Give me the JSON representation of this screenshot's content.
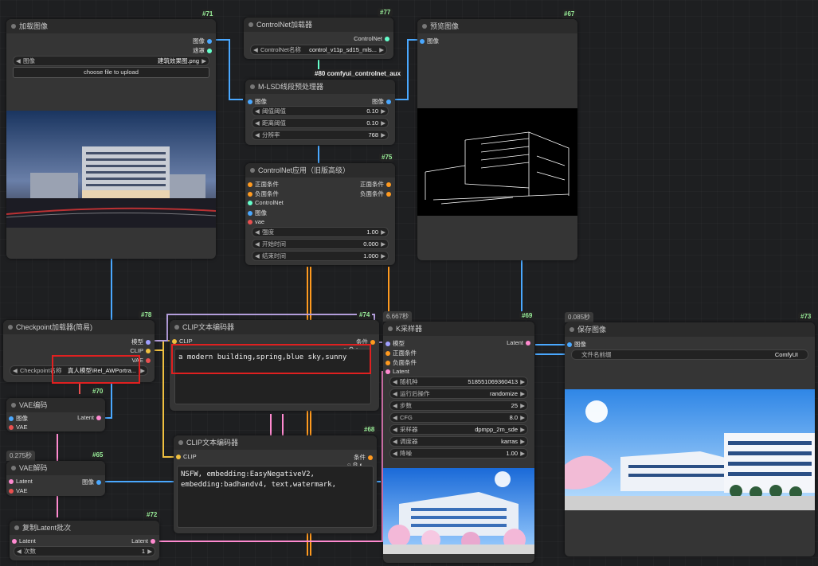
{
  "nodes": {
    "load_image": {
      "id": "#71",
      "title": "加载图像",
      "outputs": [
        "图像",
        "遮罩"
      ],
      "image_label": "图像",
      "image_value": "建筑效果图.png",
      "upload_label": "choose file to upload"
    },
    "controlnet_loader": {
      "id": "#77",
      "title": "ControlNet加载器",
      "output": "ControlNet",
      "name_label": "ControlNet名称",
      "name_value": "control_v11p_sd15_mls..."
    },
    "mlsd": {
      "group_label": "#80 comfyui_controlnet_aux",
      "title": "M-LSD线段预处理器",
      "input": "图像",
      "output": "图像",
      "widgets": [
        {
          "label": "阈值阈值",
          "value": "0.10"
        },
        {
          "label": "距离阈值",
          "value": "0.10"
        },
        {
          "label": "分辨率",
          "value": "768"
        }
      ]
    },
    "preview": {
      "id": "#67",
      "title": "预览图像",
      "input": "图像"
    },
    "cn_apply": {
      "id": "#75",
      "title": "ControlNet应用（旧版高级）",
      "inputs": [
        "正面条件",
        "负面条件",
        "ControlNet",
        "图像",
        "vae"
      ],
      "outputs": [
        "正面条件",
        "负面条件"
      ],
      "widgets": [
        {
          "label": "强度",
          "value": "1.00"
        },
        {
          "label": "开始时间",
          "value": "0.000"
        },
        {
          "label": "结束时间",
          "value": "1.000"
        }
      ]
    },
    "checkpoint": {
      "id": "#78",
      "title": "Checkpoint加载器(简易)",
      "outputs": [
        "模型",
        "CLIP",
        "VAE"
      ],
      "ckpt_label": "Checkpoint名称",
      "ckpt_value": "真人模型\\Rel_AWPortra..."
    },
    "clip_pos": {
      "id": "#74",
      "title": "CLIP文本编码器",
      "input": "CLIP",
      "output": "条件",
      "text": "a modern building,spring,blue sky,sunny"
    },
    "clip_neg": {
      "id": "#68",
      "title": "CLIP文本编码器",
      "input": "CLIP",
      "output": "条件",
      "text": "NSFW, embedding:EasyNegativeV2,\nembedding:badhandv4, text,watermark,"
    },
    "vae_encode": {
      "id": "#70",
      "title": "VAE编码",
      "inputs": [
        "图像",
        "VAE"
      ],
      "output": "Latent"
    },
    "vae_decode": {
      "id": "#65",
      "time": "0.275秒",
      "title": "VAE解码",
      "inputs": [
        "Latent",
        "VAE"
      ],
      "output": "图像"
    },
    "repeat_latent": {
      "id": "#72",
      "title": "复制Latent批次",
      "input": "Latent",
      "output": "Latent",
      "widget_label": "次数",
      "widget_value": "1"
    },
    "ksampler": {
      "id": "#69",
      "time": "6.667秒",
      "title": "K采样器",
      "inputs": [
        "模型",
        "正面条件",
        "负面条件",
        "Latent"
      ],
      "output": "Latent",
      "widgets": [
        {
          "label": "随机种",
          "value": "518551069360413"
        },
        {
          "label": "运行后操作",
          "value": "randomize"
        },
        {
          "label": "步数",
          "value": "25"
        },
        {
          "label": "CFG",
          "value": "8.0"
        },
        {
          "label": "采样器",
          "value": "dpmpp_2m_sde"
        },
        {
          "label": "调度器",
          "value": "karras"
        },
        {
          "label": "降噪",
          "value": "1.00"
        }
      ]
    },
    "save_image": {
      "id": "#73",
      "time": "0.085秒",
      "title": "保存图像",
      "input": "图像",
      "prefix_label": "文件名前缀",
      "prefix_value": "ComfyUI"
    }
  },
  "colors": {
    "accent_highlight": "#e02020",
    "clip_wire": "#f0c040",
    "model_wire": "#b39ddb",
    "cond_wire": "#ff9a1f",
    "image_wire": "#4aa8ff",
    "vae_wire": "#e95050",
    "latent_wire": "#ff8ad0"
  }
}
